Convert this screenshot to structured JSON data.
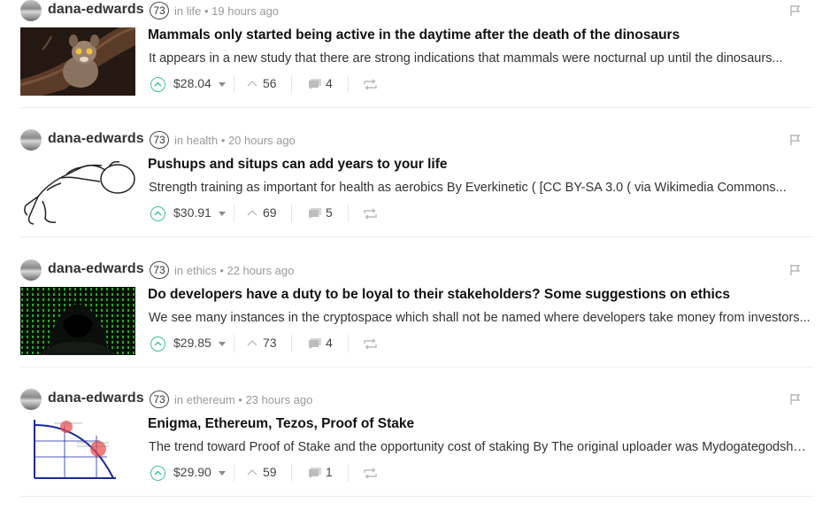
{
  "posts": [
    {
      "author": "dana-edwards",
      "reputation": "73",
      "category": "in life",
      "time": "19 hours ago",
      "thumbnail": "bushbaby-photo",
      "title": "Mammals only started being active in the daytime after the death of the dinosaurs",
      "summary": "It appears in a new study that there are strong indications that mammals were nocturnal up until the dinosaurs...",
      "payout": "$28.04",
      "votes": "56",
      "comments": "4"
    },
    {
      "author": "dana-edwards",
      "reputation": "73",
      "category": "in health",
      "time": "20 hours ago",
      "thumbnail": "pushup-sketch",
      "title": "Pushups and situps can add years to your life",
      "summary": "Strength training as important for health as aerobics By Everkinetic ( [CC BY-SA 3.0 ( via Wikimedia Commons...",
      "payout": "$30.91",
      "votes": "69",
      "comments": "5"
    },
    {
      "author": "dana-edwards",
      "reputation": "73",
      "category": "in ethics",
      "time": "22 hours ago",
      "thumbnail": "hooded-hacker-image",
      "title": "Do developers have a duty to be loyal to their stakeholders? Some suggestions on ethics",
      "summary": "We see many instances in the cryptospace which shall not be named where developers take money from investors...",
      "payout": "$29.85",
      "votes": "73",
      "comments": "4"
    },
    {
      "author": "dana-edwards",
      "reputation": "73",
      "category": "in ethereum",
      "time": "23 hours ago",
      "thumbnail": "ppf-graph-image",
      "title": "Enigma, Ethereum, Tezos, Proof of Stake",
      "summary": "The trend toward Proof of Stake and the opportunity cost of staking By The original uploader was Mydogategodshat...",
      "payout": "$29.90",
      "votes": "59",
      "comments": "1"
    }
  ],
  "colors": {
    "upvote": "#3ac58a",
    "text": "#333333",
    "muted": "#9a9a9a"
  }
}
